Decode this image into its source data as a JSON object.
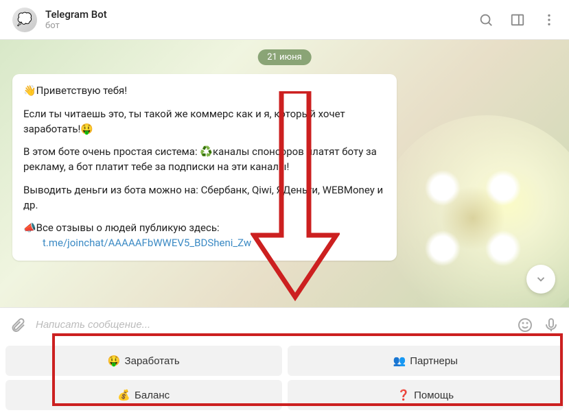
{
  "header": {
    "title": "Telegram Bot",
    "subtitle": "бот",
    "avatar_emoji": "💭"
  },
  "chat": {
    "date_label": "21 июня",
    "message": {
      "greeting": "👋Приветствую тебя!",
      "p2": "Если ты читаешь это, ты такой же коммерс как и я, который хочет заработать!🤑",
      "p3": "В этом боте очень простая система: ♻️каналы спонсоров платят боту за рекламу, а бот платит тебе за подписки на эти каналы!",
      "p4": "Выводить деньги из бота можно на: Сбербанк, Qiwi, ЯДеньги, WEBMoney и др.",
      "p5": "📣Все отзывы о людей публикую здесь:",
      "link": "t.me/joinchat/AAAAAFbWWEV5_BDSheni_Zw"
    }
  },
  "input": {
    "placeholder": "Написать сообщение..."
  },
  "keyboard": {
    "row1": [
      {
        "emoji": "🤑",
        "label": "Заработать"
      },
      {
        "emoji": "👥",
        "label": "Партнеры"
      }
    ],
    "row2": [
      {
        "emoji": "💰",
        "label": "Баланс"
      },
      {
        "emoji": "❓",
        "label": "Помощь"
      }
    ]
  }
}
